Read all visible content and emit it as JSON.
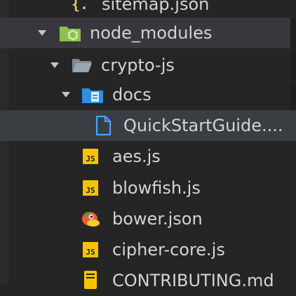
{
  "explorer": {
    "items": [
      {
        "label": "sitemap.json",
        "icon": "json-braces-icon",
        "color": "#e8c46a"
      },
      {
        "label": "node_modules",
        "icon": "folder-node-icon",
        "color": "#8bc34a"
      },
      {
        "label": "crypto-js",
        "icon": "folder-open-icon",
        "color": "#9aa7b0"
      },
      {
        "label": "docs",
        "icon": "folder-docs-icon",
        "color": "#2f8fe0"
      },
      {
        "label": "QuickStartGuide....",
        "icon": "file-icon",
        "color": "#4aa3ff"
      },
      {
        "label": "aes.js",
        "icon": "js-file-icon",
        "badge": "JS"
      },
      {
        "label": "blowfish.js",
        "icon": "js-file-icon",
        "badge": "JS"
      },
      {
        "label": "bower.json",
        "icon": "bower-bird-icon"
      },
      {
        "label": "cipher-core.js",
        "icon": "js-file-icon",
        "badge": "JS"
      },
      {
        "label": "CONTRIBUTING.md",
        "icon": "markdown-file-icon",
        "color": "#f5c400"
      }
    ]
  },
  "colors": {
    "background": "#252526",
    "row_highlight": "#37373d",
    "row_selected": "#3a3d41",
    "text": "#d4d4d4",
    "js_badge": "#f5c400"
  }
}
